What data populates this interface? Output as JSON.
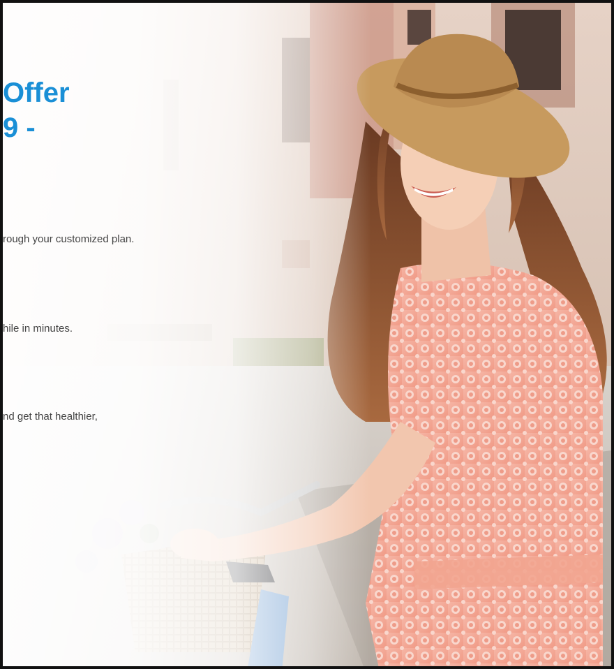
{
  "hero": {
    "headline_line1": "Offer",
    "headline_line2": "9 -",
    "lines": [
      "rough your customized plan.",
      "hile in minutes.",
      "nd get that healthier,"
    ],
    "accent_color": "#1a8fd6"
  }
}
